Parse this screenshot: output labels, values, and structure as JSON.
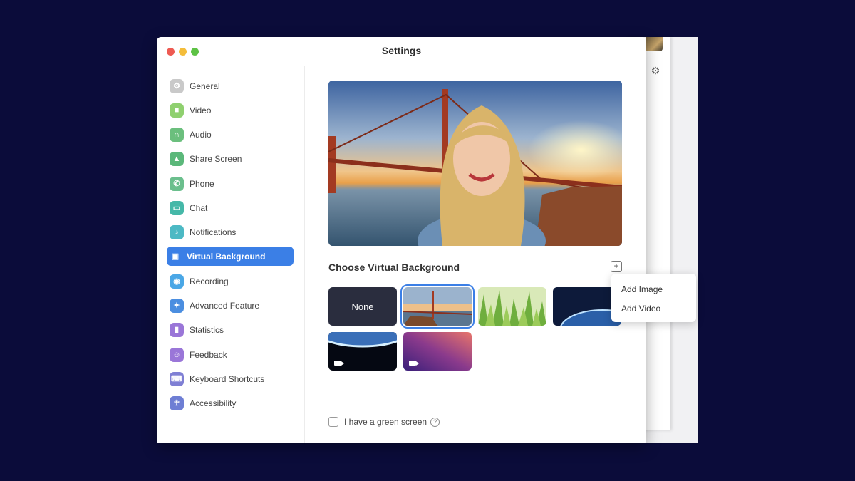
{
  "window": {
    "title": "Settings"
  },
  "sidebar": {
    "items": [
      {
        "label": "General",
        "icon": "gear-icon",
        "color": "#c9c9c9"
      },
      {
        "label": "Video",
        "icon": "video-icon",
        "color": "#8fd06f"
      },
      {
        "label": "Audio",
        "icon": "headphones-icon",
        "color": "#6bbf7d"
      },
      {
        "label": "Share Screen",
        "icon": "share-screen-icon",
        "color": "#5bb87a"
      },
      {
        "label": "Phone",
        "icon": "phone-icon",
        "color": "#6bbf8d"
      },
      {
        "label": "Chat",
        "icon": "chat-icon",
        "color": "#45b8a8"
      },
      {
        "label": "Notifications",
        "icon": "bell-icon",
        "color": "#4cb9c4"
      },
      {
        "label": "Virtual Background",
        "icon": "person-icon",
        "color": "#3b7fe6",
        "active": true
      },
      {
        "label": "Recording",
        "icon": "record-icon",
        "color": "#4aa7e6"
      },
      {
        "label": "Advanced Feature",
        "icon": "sparkle-icon",
        "color": "#4b8ee0"
      },
      {
        "label": "Statistics",
        "icon": "bar-chart-icon",
        "color": "#9a76d8"
      },
      {
        "label": "Feedback",
        "icon": "smiley-icon",
        "color": "#9a76d8"
      },
      {
        "label": "Keyboard Shortcuts",
        "icon": "keyboard-icon",
        "color": "#7f7fd4"
      },
      {
        "label": "Accessibility",
        "icon": "accessibility-icon",
        "color": "#6e7ed4"
      }
    ]
  },
  "main": {
    "section_title": "Choose Virtual Background",
    "thumbs": [
      {
        "label": "None",
        "kind": "none"
      },
      {
        "label": "",
        "kind": "golden-gate",
        "selected": true
      },
      {
        "label": "",
        "kind": "grass"
      },
      {
        "label": "",
        "kind": "earth"
      },
      {
        "label": "",
        "kind": "earth-video",
        "video": true
      },
      {
        "label": "",
        "kind": "gradient-video",
        "video": true
      }
    ],
    "green_screen_label": "I have a green screen"
  },
  "dropdown": {
    "items": [
      "Add Image",
      "Add Video"
    ]
  },
  "colors": {
    "accent": "#3b7fe6",
    "page_bg": "#0b0c3a"
  }
}
